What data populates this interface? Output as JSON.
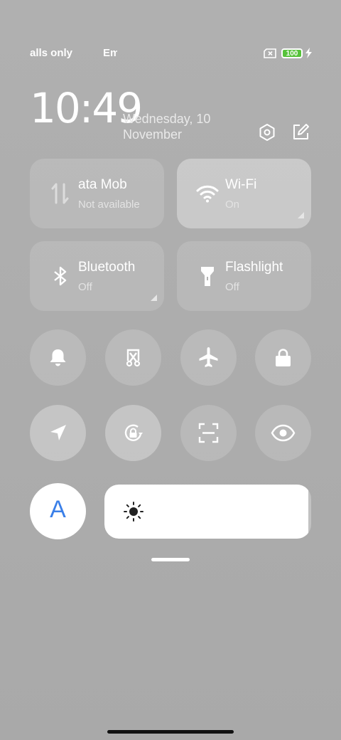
{
  "status_bar": {
    "carrier_text": "alls only",
    "carrier_text2": "Em",
    "battery_level": "100",
    "battery_color": "#56c23a"
  },
  "clock": {
    "time": "10:49",
    "date_line1": "Wednesday, 10",
    "date_line2": "November"
  },
  "tiles": [
    {
      "name": "ata    Mob",
      "status": "Not available",
      "icon": "mobile-data-icon",
      "on": false
    },
    {
      "name": "Wi-Fi",
      "status": "On",
      "icon": "wifi-icon",
      "on": true
    },
    {
      "name": "Bluetooth",
      "status": "Off",
      "icon": "bluetooth-icon",
      "on": false
    },
    {
      "name": "Flashlight",
      "status": "Off",
      "icon": "flashlight-icon",
      "on": false
    }
  ],
  "round_buttons": [
    "bell-icon",
    "screenshot-icon",
    "airplane-icon",
    "lock-icon",
    "location-icon",
    "auto-rotate-icon",
    "scan-icon",
    "eye-icon"
  ],
  "brightness": {
    "auto_label": "A",
    "auto_color": "#3a7fe8",
    "level": 0.985
  }
}
